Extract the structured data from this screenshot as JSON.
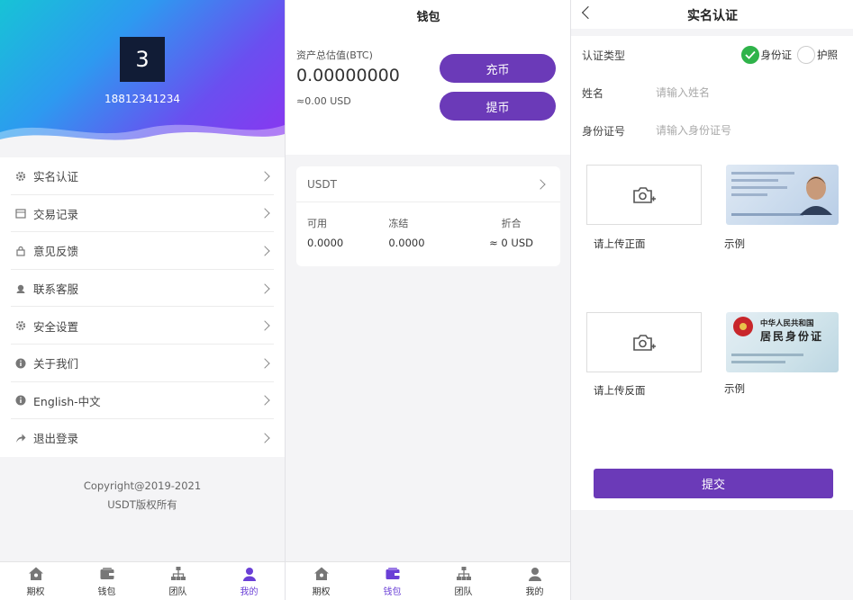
{
  "profile": {
    "avatar_text": "3",
    "phone": "18812341234",
    "menu": [
      {
        "label": "实名认证",
        "icon": "gear-icon"
      },
      {
        "label": "交易记录",
        "icon": "calendar-icon"
      },
      {
        "label": "意见反馈",
        "icon": "lock-icon"
      },
      {
        "label": "联系客服",
        "icon": "headset-icon"
      },
      {
        "label": "安全设置",
        "icon": "gear-icon"
      },
      {
        "label": "关于我们",
        "icon": "info-icon"
      },
      {
        "label": "English-中文",
        "icon": "info-icon"
      },
      {
        "label": "退出登录",
        "icon": "share-arrow-icon"
      }
    ],
    "copyright_line1": "Copyright@2019-2021",
    "copyright_line2": "USDT版权所有",
    "tabs": [
      {
        "label": "期权",
        "icon": "home-icon",
        "active": false
      },
      {
        "label": "钱包",
        "icon": "wallet-icon",
        "active": false
      },
      {
        "label": "团队",
        "icon": "team-icon",
        "active": false
      },
      {
        "label": "我的",
        "icon": "user-icon",
        "active": true
      }
    ]
  },
  "wallet": {
    "title": "钱包",
    "asset_label": "资产总估值(BTC)",
    "asset_value": "0.00000000",
    "asset_usd": "≈0.00 USD",
    "deposit_label": "充币",
    "withdraw_label": "提币",
    "coin": {
      "name": "USDT",
      "available_label": "可用",
      "available_value": "0.0000",
      "frozen_label": "冻结",
      "frozen_value": "0.0000",
      "convert_label": "折合",
      "convert_value": "≈ 0 USD"
    },
    "tabs": [
      {
        "label": "期权",
        "icon": "home-icon",
        "active": false
      },
      {
        "label": "钱包",
        "icon": "wallet-icon",
        "active": true
      },
      {
        "label": "团队",
        "icon": "team-icon",
        "active": false
      },
      {
        "label": "我的",
        "icon": "user-icon",
        "active": false
      }
    ]
  },
  "verify": {
    "title": "实名认证",
    "type_label": "认证类型",
    "option_id_card": "身份证",
    "option_passport": "护照",
    "name_label": "姓名",
    "name_placeholder": "请输入姓名",
    "id_label": "身份证号",
    "id_placeholder": "请输入身份证号",
    "upload_front_label": "请上传正面",
    "upload_back_label": "请上传反面",
    "sample_label": "示例",
    "sample_back_line1": "中华人民共和国",
    "sample_back_line2": "居民身份证",
    "submit_label": "提交"
  },
  "colors": {
    "accent": "#6b3ab8",
    "active_tab": "#6a3fd6",
    "check_green": "#2fb34a"
  }
}
